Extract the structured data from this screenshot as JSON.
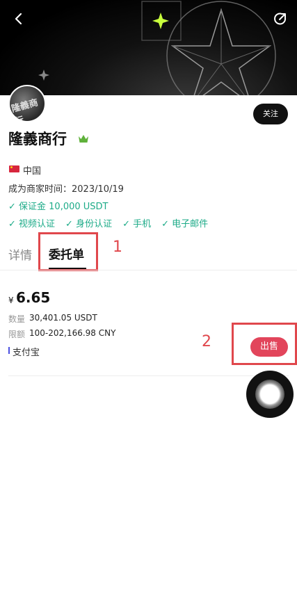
{
  "header": {
    "back_icon": "chevron-left-icon",
    "share_icon": "share-icon"
  },
  "profile": {
    "avatar_text": "隆義商行",
    "name": "隆義商行",
    "crown_icon": "crown-icon",
    "crown_color": "#5fb13b",
    "follow_label": "关注",
    "country": "中国",
    "merchant_since": "成为商家时间：2023/10/19",
    "deposit": "保证金 10,000 USDT",
    "verifications": [
      "视频认证",
      "身份认证",
      "手机",
      "电子邮件"
    ],
    "accent_color": "#1dab88"
  },
  "tabs": {
    "details": "详情",
    "orders": "委托单"
  },
  "annotations": {
    "label1": "1",
    "label2": "2",
    "color": "#e0474c"
  },
  "order": {
    "currency_symbol": "¥",
    "price": "6.65",
    "quantity_label": "数量",
    "quantity_value": "30,401.05 USDT",
    "limit_label": "限额",
    "limit_value": "100-202,166.98 CNY",
    "payment_method": "支付宝",
    "sell_label": "出售",
    "sell_color": "#e2455b"
  }
}
